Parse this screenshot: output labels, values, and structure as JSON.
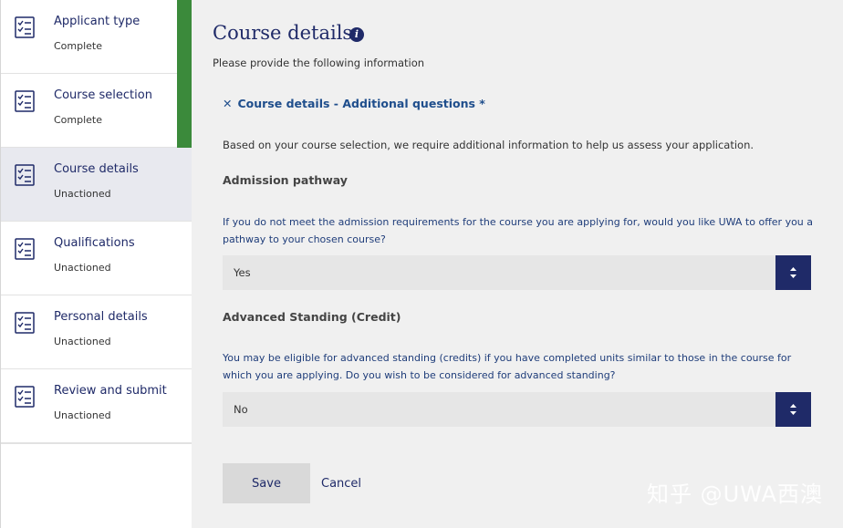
{
  "sidebar": {
    "steps": [
      {
        "label": "Applicant type",
        "status": "Complete"
      },
      {
        "label": "Course selection",
        "status": "Complete"
      },
      {
        "label": "Course details",
        "status": "Unactioned"
      },
      {
        "label": "Qualifications",
        "status": "Unactioned"
      },
      {
        "label": "Personal details",
        "status": "Unactioned"
      },
      {
        "label": "Review and submit",
        "status": "Unactioned"
      }
    ]
  },
  "main": {
    "title": "Course details",
    "info_glyph": "i",
    "subtitle": "Please provide the following information",
    "section": {
      "close_glyph": "✕",
      "label": "Course details - Additional questions *"
    },
    "intro": "Based on your course selection, we require additional information to help us assess your application.",
    "questions": [
      {
        "title": "Admission pathway",
        "text": "If you do not meet the admission requirements for the course you are applying for, would you like UWA to offer you a pathway to your chosen course?",
        "value": "Yes"
      },
      {
        "title": "Advanced Standing (Credit)",
        "text": "You may be eligible for advanced standing (credits) if you have completed units similar to those in the course for which you are applying. Do you wish to be considered for advanced standing?",
        "value": "No"
      }
    ],
    "save_label": "Save",
    "cancel_label": "Cancel"
  },
  "watermark": "知乎 @UWA西澳",
  "colors": {
    "navy": "#1f2a68",
    "complete_green": "#3b8a3b",
    "active_bg": "#e8e9ef"
  },
  "icons": {
    "step": "checklist-icon",
    "select": "sort-arrows-icon"
  }
}
